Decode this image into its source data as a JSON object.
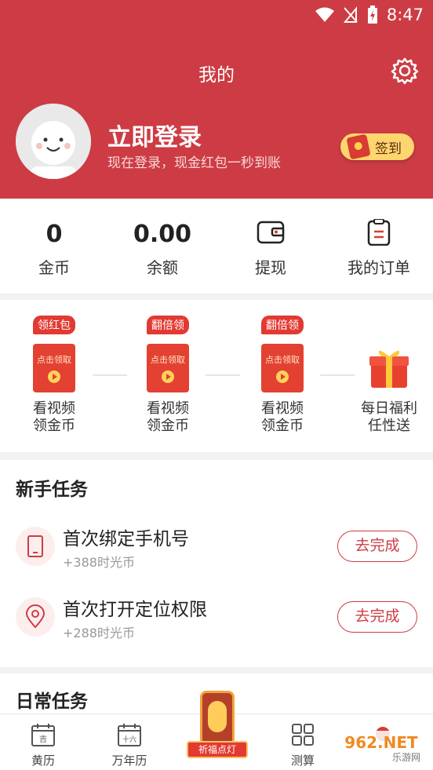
{
  "status_bar": {
    "time": "8:47"
  },
  "header": {
    "title": "我的",
    "login_title": "立即登录",
    "login_subtitle": "现在登录，现金红包一秒到账",
    "signin_label": "签到"
  },
  "stats": [
    {
      "value": "0",
      "label": "金币"
    },
    {
      "value": "0.00",
      "label": "余额"
    },
    {
      "label": "提现",
      "icon": "withdraw-icon"
    },
    {
      "label": "我的订单",
      "icon": "orders-icon"
    }
  ],
  "rewards": [
    {
      "tag": "领红包",
      "card_text": "点击领取",
      "line1": "看视频",
      "line2": "领金币"
    },
    {
      "tag": "翻倍领",
      "card_text": "点击领取",
      "line1": "看视频",
      "line2": "领金币"
    },
    {
      "tag": "翻倍领",
      "card_text": "点击领取",
      "line1": "看视频",
      "line2": "领金币"
    },
    {
      "line1": "每日福利",
      "line2": "任性送",
      "icon": "gift-icon"
    }
  ],
  "newbie": {
    "title": "新手任务",
    "tasks": [
      {
        "name": "首次绑定手机号",
        "reward": "+388时光币",
        "button": "去完成",
        "icon": "phone-icon"
      },
      {
        "name": "首次打开定位权限",
        "reward": "+288时光币",
        "button": "去完成",
        "icon": "location-icon"
      }
    ]
  },
  "daily": {
    "title": "日常任务"
  },
  "tabbar": {
    "items": [
      {
        "label": "黄历",
        "icon": "calendar-icon",
        "icon_text": "吉"
      },
      {
        "label": "万年历",
        "icon": "calendar-icon",
        "icon_text": "十六"
      },
      {
        "label": "祈福点灯",
        "icon": "lantern-icon"
      },
      {
        "label": "测算",
        "icon": "grid-icon"
      }
    ]
  },
  "watermark": {
    "line1": "962.NET",
    "line2": "乐游网"
  },
  "colors": {
    "brand_red": "#cd3c44",
    "gold": "#ffd66e"
  }
}
